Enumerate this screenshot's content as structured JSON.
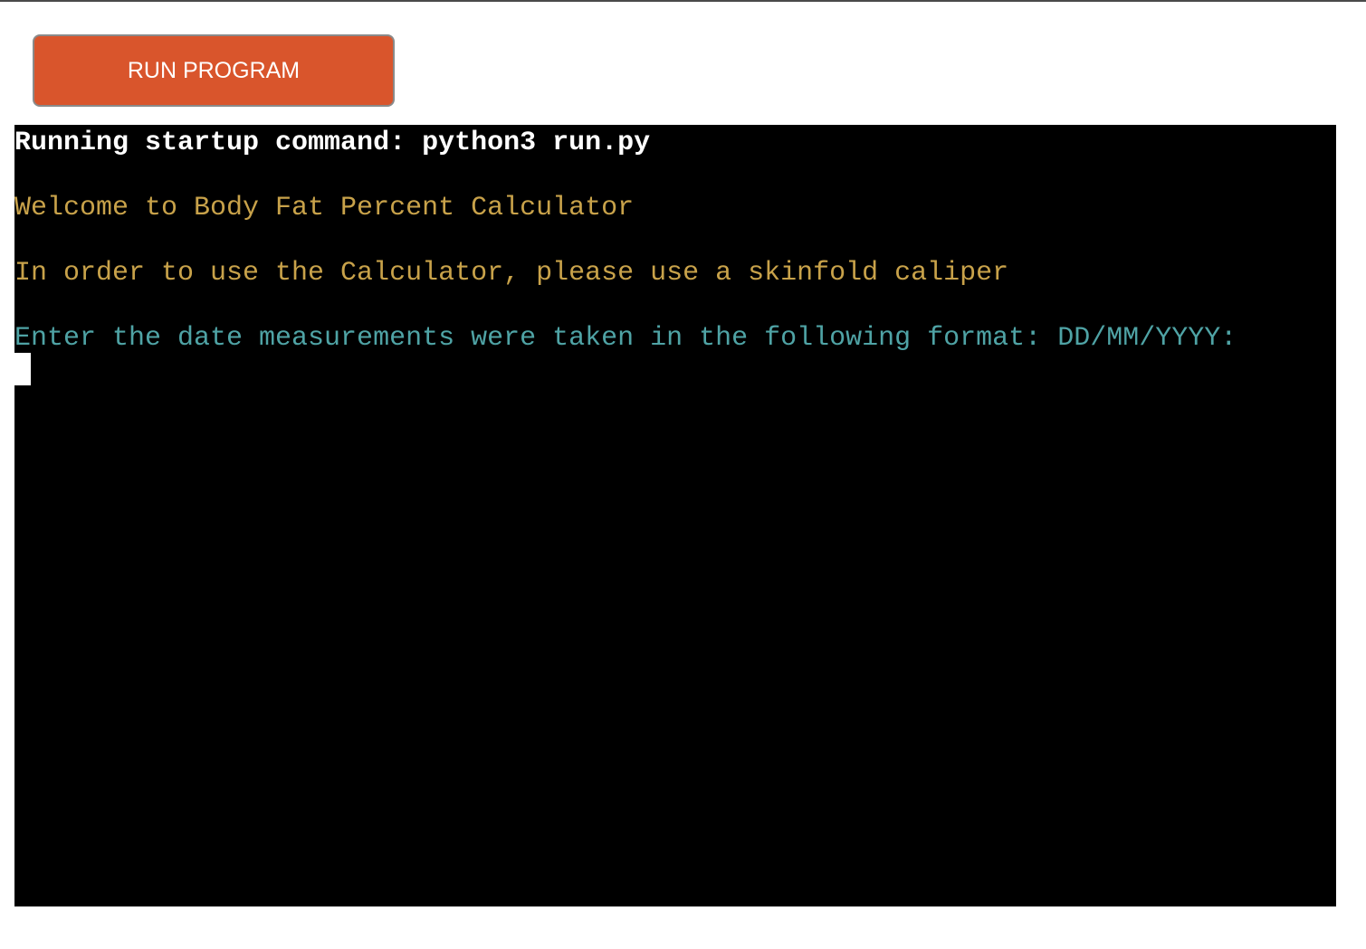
{
  "run_button": {
    "label": "RUN PROGRAM",
    "color": "#d9552c"
  },
  "terminal": {
    "background": "#000000",
    "lines": [
      {
        "text": "Running startup command: python3 run.py",
        "color": "#ffffff"
      },
      {
        "text": "Welcome to Body Fat Percent Calculator",
        "color": "#c8a24a"
      },
      {
        "text": "In order to use the Calculator, please use a skinfold caliper",
        "color": "#c8a24a"
      },
      {
        "text": "Enter the date measurements were taken in the following format: DD/MM/YYYY:",
        "color": "#4fa3a5"
      }
    ],
    "input_value": ""
  }
}
